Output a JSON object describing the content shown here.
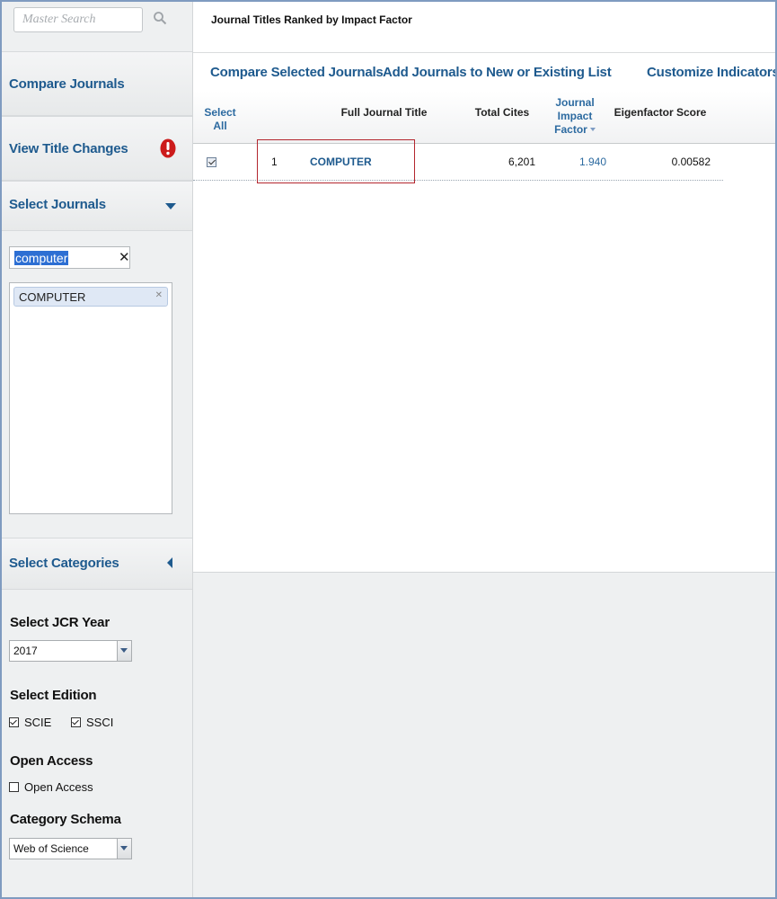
{
  "sidebar": {
    "search_placeholder": "Master Search",
    "compare_journals": "Compare Journals",
    "view_title_changes": "View Title Changes",
    "select_journals": "Select Journals",
    "journal_search_value": "computer",
    "selected_journals": [
      "COMPUTER"
    ],
    "select_categories": "Select Categories",
    "jcr_year_heading": "Select JCR Year",
    "jcr_year_value": "2017",
    "edition_heading": "Select Edition",
    "edition_scie": "SCIE",
    "edition_ssci": "SSCI",
    "open_access_heading": "Open Access",
    "open_access_option": "Open Access",
    "category_schema_heading": "Category Schema",
    "category_schema_value": "Web of Science"
  },
  "main": {
    "title": "Journal Titles Ranked by Impact Factor",
    "actions": {
      "compare": "Compare Selected Journals",
      "add_to_list": "Add Journals to New or Existing List",
      "customize": "Customize Indicators"
    },
    "table": {
      "headers": {
        "select_all_1": "Select",
        "select_all_2": "All",
        "full_title": "Full Journal Title",
        "total_cites": "Total Cites",
        "jif_1": "Journal",
        "jif_2": "Impact",
        "jif_3": "Factor",
        "eigenfactor": "Eigenfactor Score"
      },
      "rows": [
        {
          "rank": "1",
          "title": "COMPUTER",
          "total_cites": "6,201",
          "jif": "1.940",
          "eigenfactor": "0.00582"
        }
      ]
    }
  },
  "colors": {
    "link": "#1e5a8e",
    "alert": "#cc1b1b",
    "highlight": "#b3262e"
  }
}
